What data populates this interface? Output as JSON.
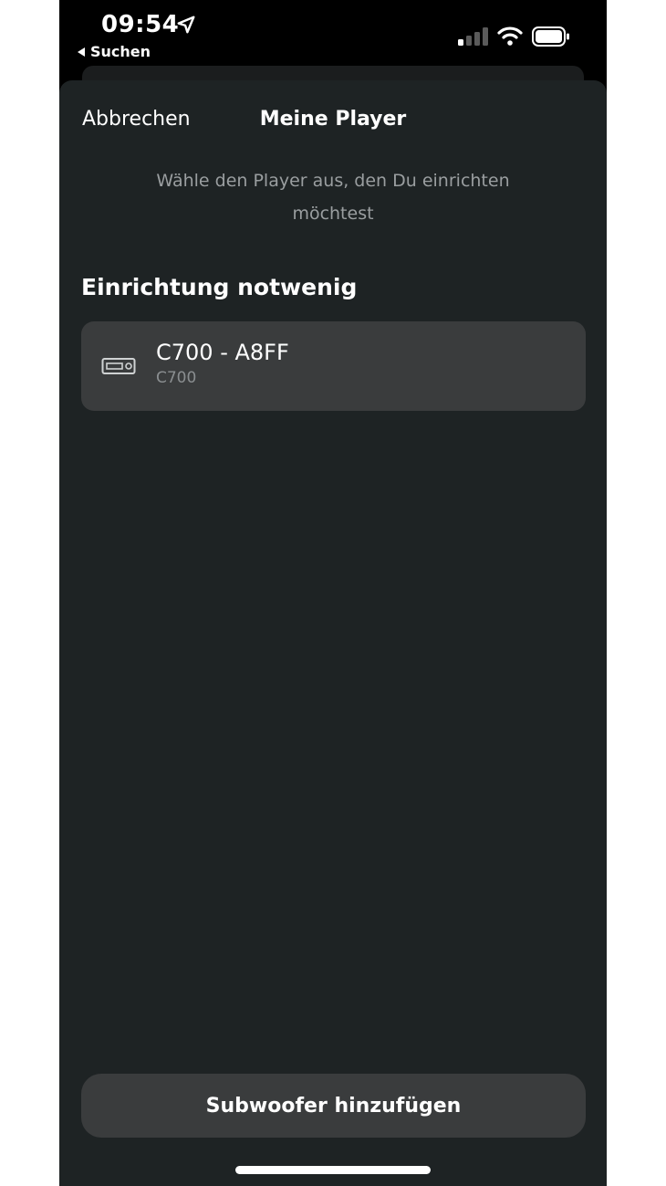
{
  "status_bar": {
    "time": "09:54",
    "back_label": "Suchen"
  },
  "sheet": {
    "cancel_label": "Abbrechen",
    "title": "Meine Player",
    "subtitle": "Wähle den Player aus, den Du einrichten möchtest"
  },
  "section": {
    "heading": "Einrichtung notwenig"
  },
  "devices": [
    {
      "name": "C700 - A8FF",
      "model": "C700",
      "icon": "player-device-icon"
    }
  ],
  "footer": {
    "subwoofer_label": "Subwoofer hinzufügen"
  },
  "colors": {
    "sheet_background": "#1e2324",
    "card_background": "#3a3c3d",
    "subtitle_text": "#9a9ea0"
  }
}
